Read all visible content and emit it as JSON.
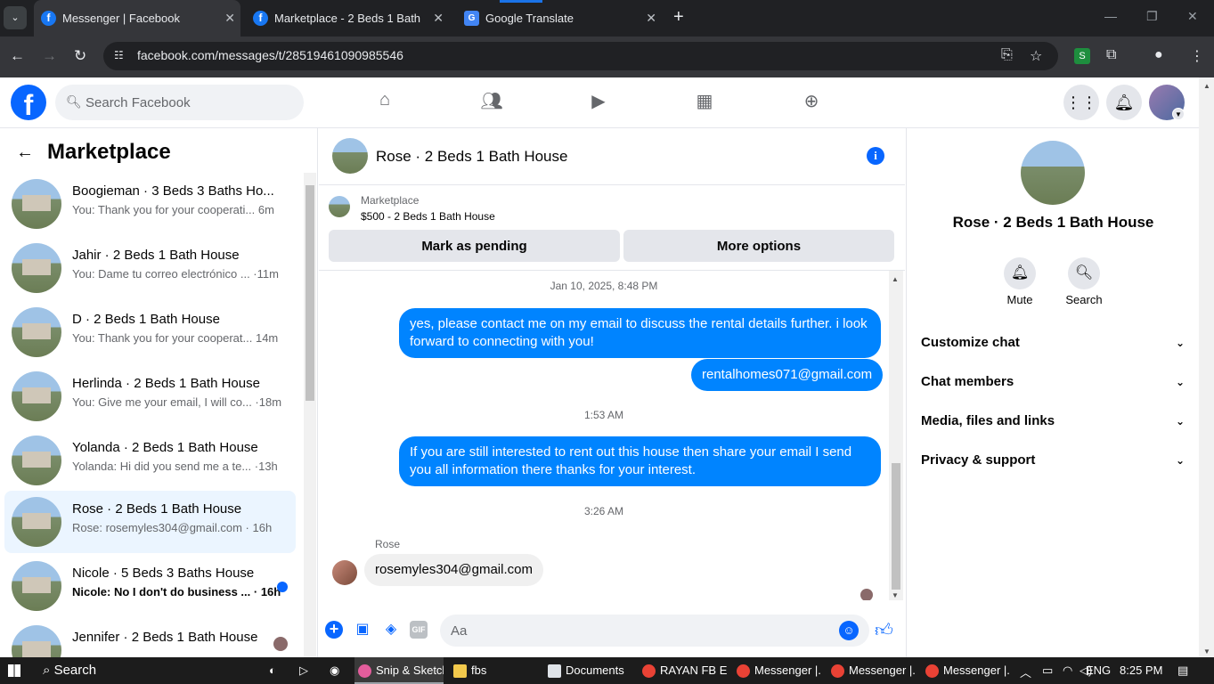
{
  "browser": {
    "tabs": [
      {
        "title": "Messenger | Facebook",
        "active": true,
        "icon": "facebook-icon"
      },
      {
        "title": "Marketplace - 2 Beds 1 Bath House",
        "active": false,
        "icon": "facebook-icon"
      },
      {
        "title": "Google Translate",
        "active": false,
        "icon": "translate-icon"
      }
    ],
    "url": "facebook.com/messages/t/28519461090985546"
  },
  "fb": {
    "search_placeholder": "Search Facebook",
    "brand_color": "#0866ff"
  },
  "left": {
    "title": "Marketplace",
    "conversations": [
      {
        "name": "Boogieman · 3 Beds 3 Baths Ho...",
        "preview": "You: Thank you for your cooperati...  6m"
      },
      {
        "name": "Jahir · 2 Beds 1 Bath House",
        "preview": "You: Dame tu correo electrónico ... ·11m"
      },
      {
        "name": "D · 2 Beds 1 Bath House",
        "preview": "You: Thank you for your cooperat... 14m"
      },
      {
        "name": "Herlinda · 2 Beds 1 Bath House",
        "preview": "You: Give me your email, I will co... ·18m"
      },
      {
        "name": "Yolanda · 2 Beds 1 Bath House",
        "preview": "Yolanda: Hi did you send me a te... ·13h"
      },
      {
        "name": "Rose · 2 Beds 1 Bath House",
        "preview": "Rose: rosemyles304@gmail.com · 16h",
        "active": true
      },
      {
        "name": "Nicole · 5 Beds 3 Baths House",
        "preview": "Nicole: No I don't do business ... · 16h",
        "unread": true
      },
      {
        "name": "Jennifer · 2 Beds 1 Bath House",
        "preview": ""
      }
    ]
  },
  "chat": {
    "title": "Rose · 2 Beds 1 Bath House",
    "marketplace_label": "Marketplace",
    "listing": "$500 - 2 Beds 1 Bath House",
    "btn_pending": "Mark as pending",
    "btn_more": "More options",
    "ts1": "Jan 10, 2025, 8:48 PM",
    "msg1": "yes, please contact me on my email to discuss the rental details further. i look forward to connecting with you!",
    "msg2": "rentalhomes071@gmail.com",
    "ts2": "1:53 AM",
    "msg3": "If you are still interested to rent out this house then share your email  I send you all information there thanks for your interest.",
    "ts3": "3:26 AM",
    "sender": "Rose",
    "msg4": "rosemyles304@gmail.com",
    "composer_placeholder": "Aa"
  },
  "right": {
    "name": "Rose · 2 Beds 1 Bath House",
    "mute": "Mute",
    "search": "Search",
    "rows": [
      "Customize chat",
      "Chat members",
      "Media, files and links",
      "Privacy & support"
    ]
  },
  "taskbar": {
    "search": "Search",
    "apps": [
      "Snip & Sketch",
      "fbs",
      "Documents",
      "RAYAN FB E...",
      "Messenger |...",
      "Messenger |...",
      "Messenger |..."
    ],
    "lang": "ENG",
    "time": "8:25 PM"
  }
}
